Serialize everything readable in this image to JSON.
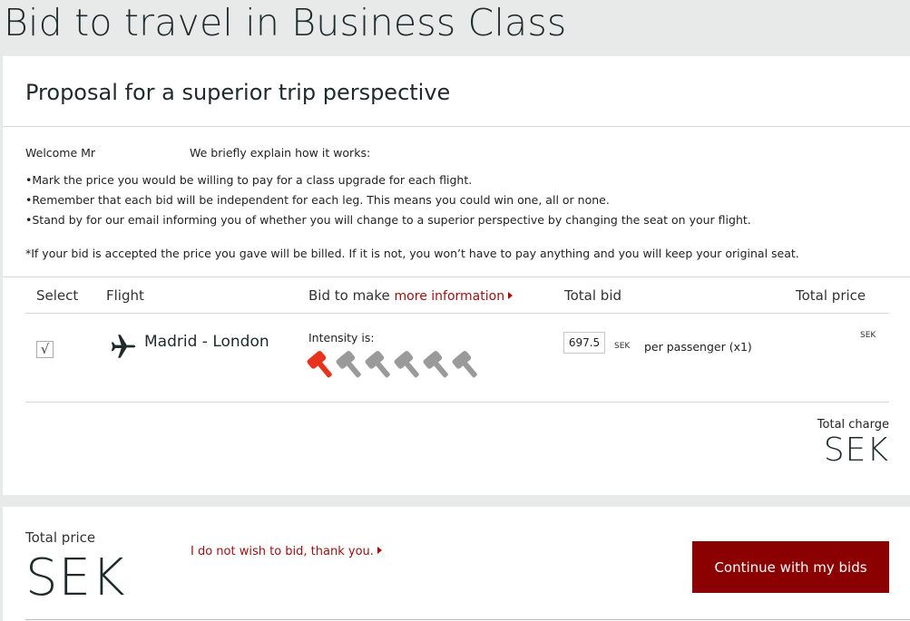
{
  "page": {
    "title": "Bid to travel in Business Class"
  },
  "card": {
    "title": "Proposal for a superior trip perspective",
    "welcome": "Welcome Mr",
    "explain": "We briefly explain how it works:",
    "bullets": [
      "Mark the price you would be willing to pay for a class upgrade for each flight.",
      "Remember that each bid will be independent for each leg. This means you could win one, all or none.",
      "Stand by for our email informing you of whether you will change to a superior perspective by changing the seat on your flight."
    ],
    "note": "*If your bid is accepted the price you gave will be billed. If it is not, you won’t have to pay anything and you will keep your original seat."
  },
  "table": {
    "headers": {
      "select": "Select",
      "flight": "Flight",
      "bid": "Bid to make",
      "more_info": "more information",
      "total_bid": "Total bid",
      "total_price": "Total price"
    },
    "row": {
      "checked": true,
      "check_mark": "√",
      "route": "Madrid - London",
      "intensity_label": "Intensity is:",
      "intensity_level": 1,
      "intensity_max": 6,
      "bid_value": "697.5",
      "currency": "SEK",
      "per_passenger": "per passenger (x1)",
      "price_currency": "SEK"
    },
    "total_charge_label": "Total charge",
    "total_charge_value": "SEK"
  },
  "footer": {
    "total_price_label": "Total price",
    "total_price_value": "SEK",
    "decline_link": "I do not wish to bid, thank you.",
    "continue_button": "Continue with my bids"
  },
  "colors": {
    "accent": "#a01010",
    "button": "#8b0000",
    "gavel_active": "#e8321e",
    "gavel_inactive": "#9a9a9a"
  },
  "icons": {
    "flight": "airplane-icon",
    "bid_intensity": "gavel-icon"
  }
}
